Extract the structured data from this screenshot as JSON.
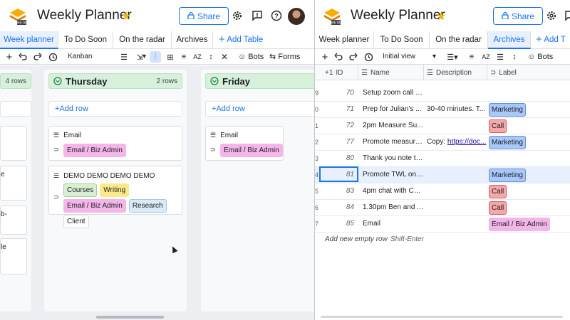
{
  "left": {
    "header": {
      "title": "Weekly Planner",
      "share_label": "Share",
      "badge": "BETA"
    },
    "tabs": [
      "Week planner",
      "To Do Soon",
      "On the radar",
      "Archives"
    ],
    "add_table_label": "Add Table",
    "toolbar": {
      "view": "Kanban",
      "bots_label": "Bots",
      "forms_label": "Forms"
    },
    "partial_column": {
      "count": "4 rows",
      "card_fragments": [
        "e",
        "b-",
        "le"
      ]
    },
    "columns": [
      {
        "title": "Thursday",
        "count": "2 rows",
        "add_row_label": "Add row",
        "cards": [
          {
            "text": "Email",
            "labels": [
              "Email / Biz Admin"
            ]
          },
          {
            "text": "DEMO DEMO DEMO DEMO",
            "labels": [
              "Courses",
              "Writing",
              "Email / Biz Admin",
              "Research",
              "Client"
            ]
          }
        ]
      },
      {
        "title": "Friday",
        "add_row_label": "Add row",
        "cards": [
          {
            "text": "Email",
            "labels": [
              "Email / Biz Admin"
            ]
          }
        ]
      }
    ]
  },
  "right": {
    "header": {
      "title": "Weekly Planner",
      "share_label": "Share",
      "badge": "BETA"
    },
    "tabs": [
      "Week planner",
      "To Do Soon",
      "On the radar",
      "Archives"
    ],
    "add_table_label": "Add T",
    "toolbar": {
      "view": "Initial view",
      "bots_label": "Bots"
    },
    "columns": {
      "id": "ID",
      "id_prefix": "+1",
      "name": "Name",
      "description": "Description",
      "label": "Label"
    },
    "rows": [
      {
        "num": "9",
        "id": "70",
        "name": "Setup zoom call w...",
        "description": "",
        "label": ""
      },
      {
        "num": "0",
        "id": "71",
        "name": "Prep for Julian's ...",
        "description": "30-40 minutes. T...",
        "label": "Marketing"
      },
      {
        "num": "1",
        "id": "72",
        "name": "2pm Measure Su...",
        "description": "",
        "label": "Call"
      },
      {
        "num": "2",
        "id": "77",
        "name": "Promote measure...",
        "description_prefix": "Copy: ",
        "description_link": "https://doc...",
        "label": "Marketing"
      },
      {
        "num": "3",
        "id": "80",
        "name": "Thank you note to...",
        "description": "",
        "label": ""
      },
      {
        "num": "4",
        "id": "81",
        "name": "Promote TWL on ...",
        "description": "",
        "label": "Marketing"
      },
      {
        "num": "5",
        "id": "83",
        "name": "4pm chat with Car...",
        "description": "",
        "label": "Call"
      },
      {
        "num": "6",
        "id": "84",
        "name": "1.30pm Ben and A...",
        "description": "",
        "label": "Call"
      },
      {
        "num": "7",
        "id": "85",
        "name": "Email",
        "description": "",
        "label": "Email / Biz Admin"
      }
    ],
    "empty_row_label": "Add new empty row",
    "empty_row_hint": "Shift-Enter"
  },
  "label_colors": {
    "Email / Biz Admin": {
      "bg": "#f4b5e9",
      "border": "#f4b5e9"
    },
    "Courses": {
      "bg": "#d8f0d0",
      "border": "#a8c8a0"
    },
    "Writing": {
      "bg": "#fbe98a",
      "border": "#fbe98a"
    },
    "Research": {
      "bg": "#dbeaf7",
      "border": "#a9c4dc"
    },
    "Client": {
      "bg": "#ffffff",
      "border": "#dadce0"
    },
    "Marketing": {
      "bg": "#a8c7fa",
      "border": "#6b8fd6"
    },
    "Call": {
      "bg": "#f4a8a8",
      "border": "#d06060"
    }
  },
  "accent_color": "#1a73e8"
}
